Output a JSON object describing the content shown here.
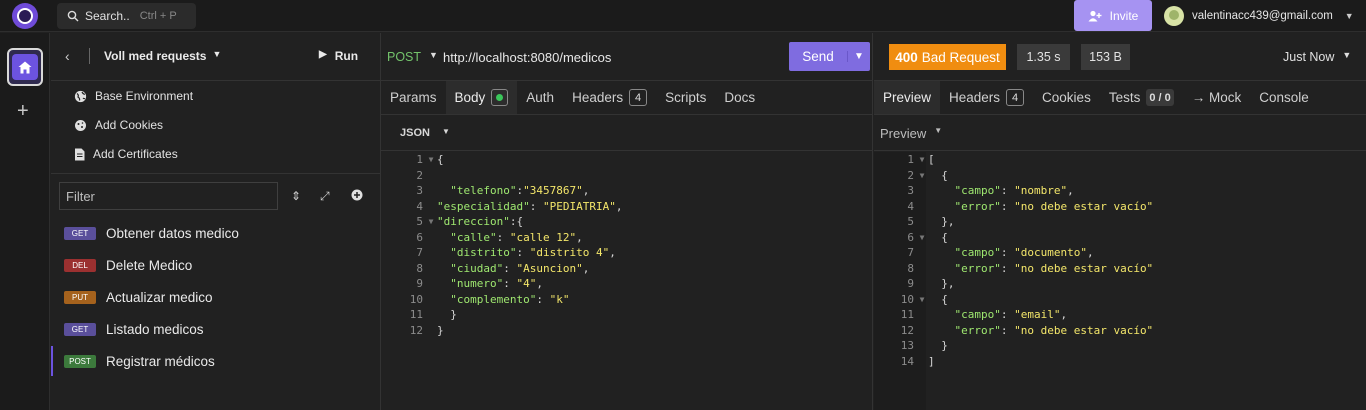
{
  "topbar": {
    "search_label": "Search..",
    "search_shortcut": "Ctrl + P",
    "invite_label": "Invite",
    "account_email": "valentinacc439@gmail.com"
  },
  "sidebar": {
    "collection_name": "Voll med requests",
    "run_label": "Run",
    "env_items": [
      {
        "label": "Base Environment",
        "icon": "globe-icon"
      },
      {
        "label": "Add Cookies",
        "icon": "cookie-icon"
      },
      {
        "label": "Add Certificates",
        "icon": "certificate-icon"
      }
    ],
    "filter_placeholder": "Filter",
    "requests": [
      {
        "method": "GET",
        "label": "Obtener datos medico"
      },
      {
        "method": "DEL",
        "label": "Delete Medico"
      },
      {
        "method": "PUT",
        "label": "Actualizar medico"
      },
      {
        "method": "GET",
        "label": "Listado medicos"
      },
      {
        "method": "POST",
        "label": "Registrar médicos",
        "active": true
      }
    ]
  },
  "request": {
    "method": "POST",
    "url": "http://localhost:8080/medicos",
    "send_label": "Send",
    "tabs": [
      {
        "label": "Params"
      },
      {
        "label": "Body",
        "active": true
      },
      {
        "label": "Auth"
      },
      {
        "label": "Headers",
        "count": "4"
      },
      {
        "label": "Scripts"
      },
      {
        "label": "Docs"
      }
    ],
    "body_type": "JSON",
    "line_numbers": [
      "1",
      "2",
      "3",
      "4",
      "5",
      "6",
      "7",
      "8",
      "9",
      "10",
      "11",
      "12"
    ],
    "body_lines": {
      "l1": "{",
      "l3_key": "\"telefono\"",
      "l3_val": "\"3457867\"",
      "l4_key": "\"especialidad\"",
      "l4_val": "\"PEDIATRIA\"",
      "l5_key": "\"direccion\"",
      "l6_key": "\"calle\"",
      "l6_val": "\"calle 12\"",
      "l7_key": "\"distrito\"",
      "l7_val": "\"distrito 4\"",
      "l8_key": "\"ciudad\"",
      "l8_val": "\"Asuncion\"",
      "l9_key": "\"numero\"",
      "l9_val": "\"4\"",
      "l10_key": "\"complemento\"",
      "l10_val": "\"k\"",
      "l11": "}",
      "l12": "}"
    }
  },
  "response": {
    "status_code": "400",
    "status_text": "Bad Request",
    "time": "1.35 s",
    "size": "153 B",
    "timestamp": "Just Now",
    "tabs": [
      {
        "label": "Preview",
        "active": true
      },
      {
        "label": "Headers",
        "count": "4"
      },
      {
        "label": "Cookies"
      },
      {
        "label": "Tests",
        "count": "0 / 0"
      },
      {
        "label": "→ Mock"
      },
      {
        "label": "Console"
      }
    ],
    "preview_label": "Preview",
    "line_numbers": [
      "1",
      "2",
      "3",
      "4",
      "5",
      "6",
      "7",
      "8",
      "9",
      "10",
      "11",
      "12",
      "13",
      "14"
    ],
    "items": [
      {
        "campo_key": "\"campo\"",
        "campo_val": "\"nombre\"",
        "error_key": "\"error\"",
        "error_val": "\"no debe estar vacío\""
      },
      {
        "campo_key": "\"campo\"",
        "campo_val": "\"documento\"",
        "error_key": "\"error\"",
        "error_val": "\"no debe estar vacío\""
      },
      {
        "campo_key": "\"campo\"",
        "campo_val": "\"email\"",
        "error_key": "\"error\"",
        "error_val": "\"no debe estar vacío\""
      }
    ]
  },
  "colors": {
    "accent": "#7f6ce0",
    "status_error": "#f08d10",
    "json_key": "#9fe870",
    "json_string": "#f3e66a"
  }
}
